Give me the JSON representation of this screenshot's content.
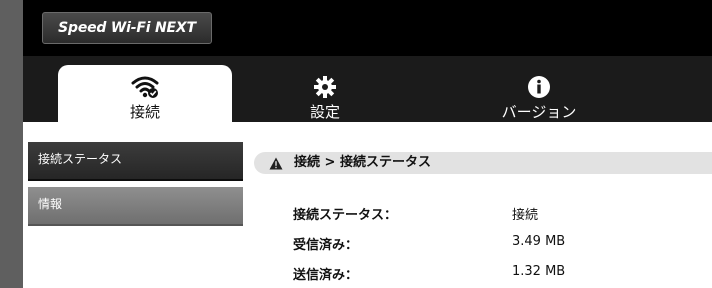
{
  "header": {
    "logo_text": "Speed Wi-Fi NEXT"
  },
  "nav": {
    "tabs": [
      {
        "label": "接続",
        "icon": "wifi-check-icon",
        "active": true
      },
      {
        "label": "設定",
        "icon": "gear-icon",
        "active": false
      },
      {
        "label": "バージョン",
        "icon": "info-icon",
        "active": false
      }
    ]
  },
  "sidebar": {
    "items": [
      {
        "label": "接続ステータス",
        "selected": true
      },
      {
        "label": "情報",
        "selected": false
      }
    ]
  },
  "breadcrumb": {
    "text": "接続 > 接続ステータス",
    "icon": "warning-icon"
  },
  "status": {
    "rows": [
      {
        "label": "接続ステータス：",
        "value": "接続"
      },
      {
        "label": "受信済み：",
        "value": "3.49 MB"
      },
      {
        "label": "送信済み：",
        "value": "1.32 MB"
      }
    ]
  },
  "colors": {
    "header_bg": "#000000",
    "nav_bg": "#1b1b1b",
    "active_tab_bg": "#ffffff",
    "sidebar_selected": "#2f2f2f",
    "sidebar_normal": "#7f7f7f",
    "breadcrumb_bg": "#e2e2e2"
  }
}
